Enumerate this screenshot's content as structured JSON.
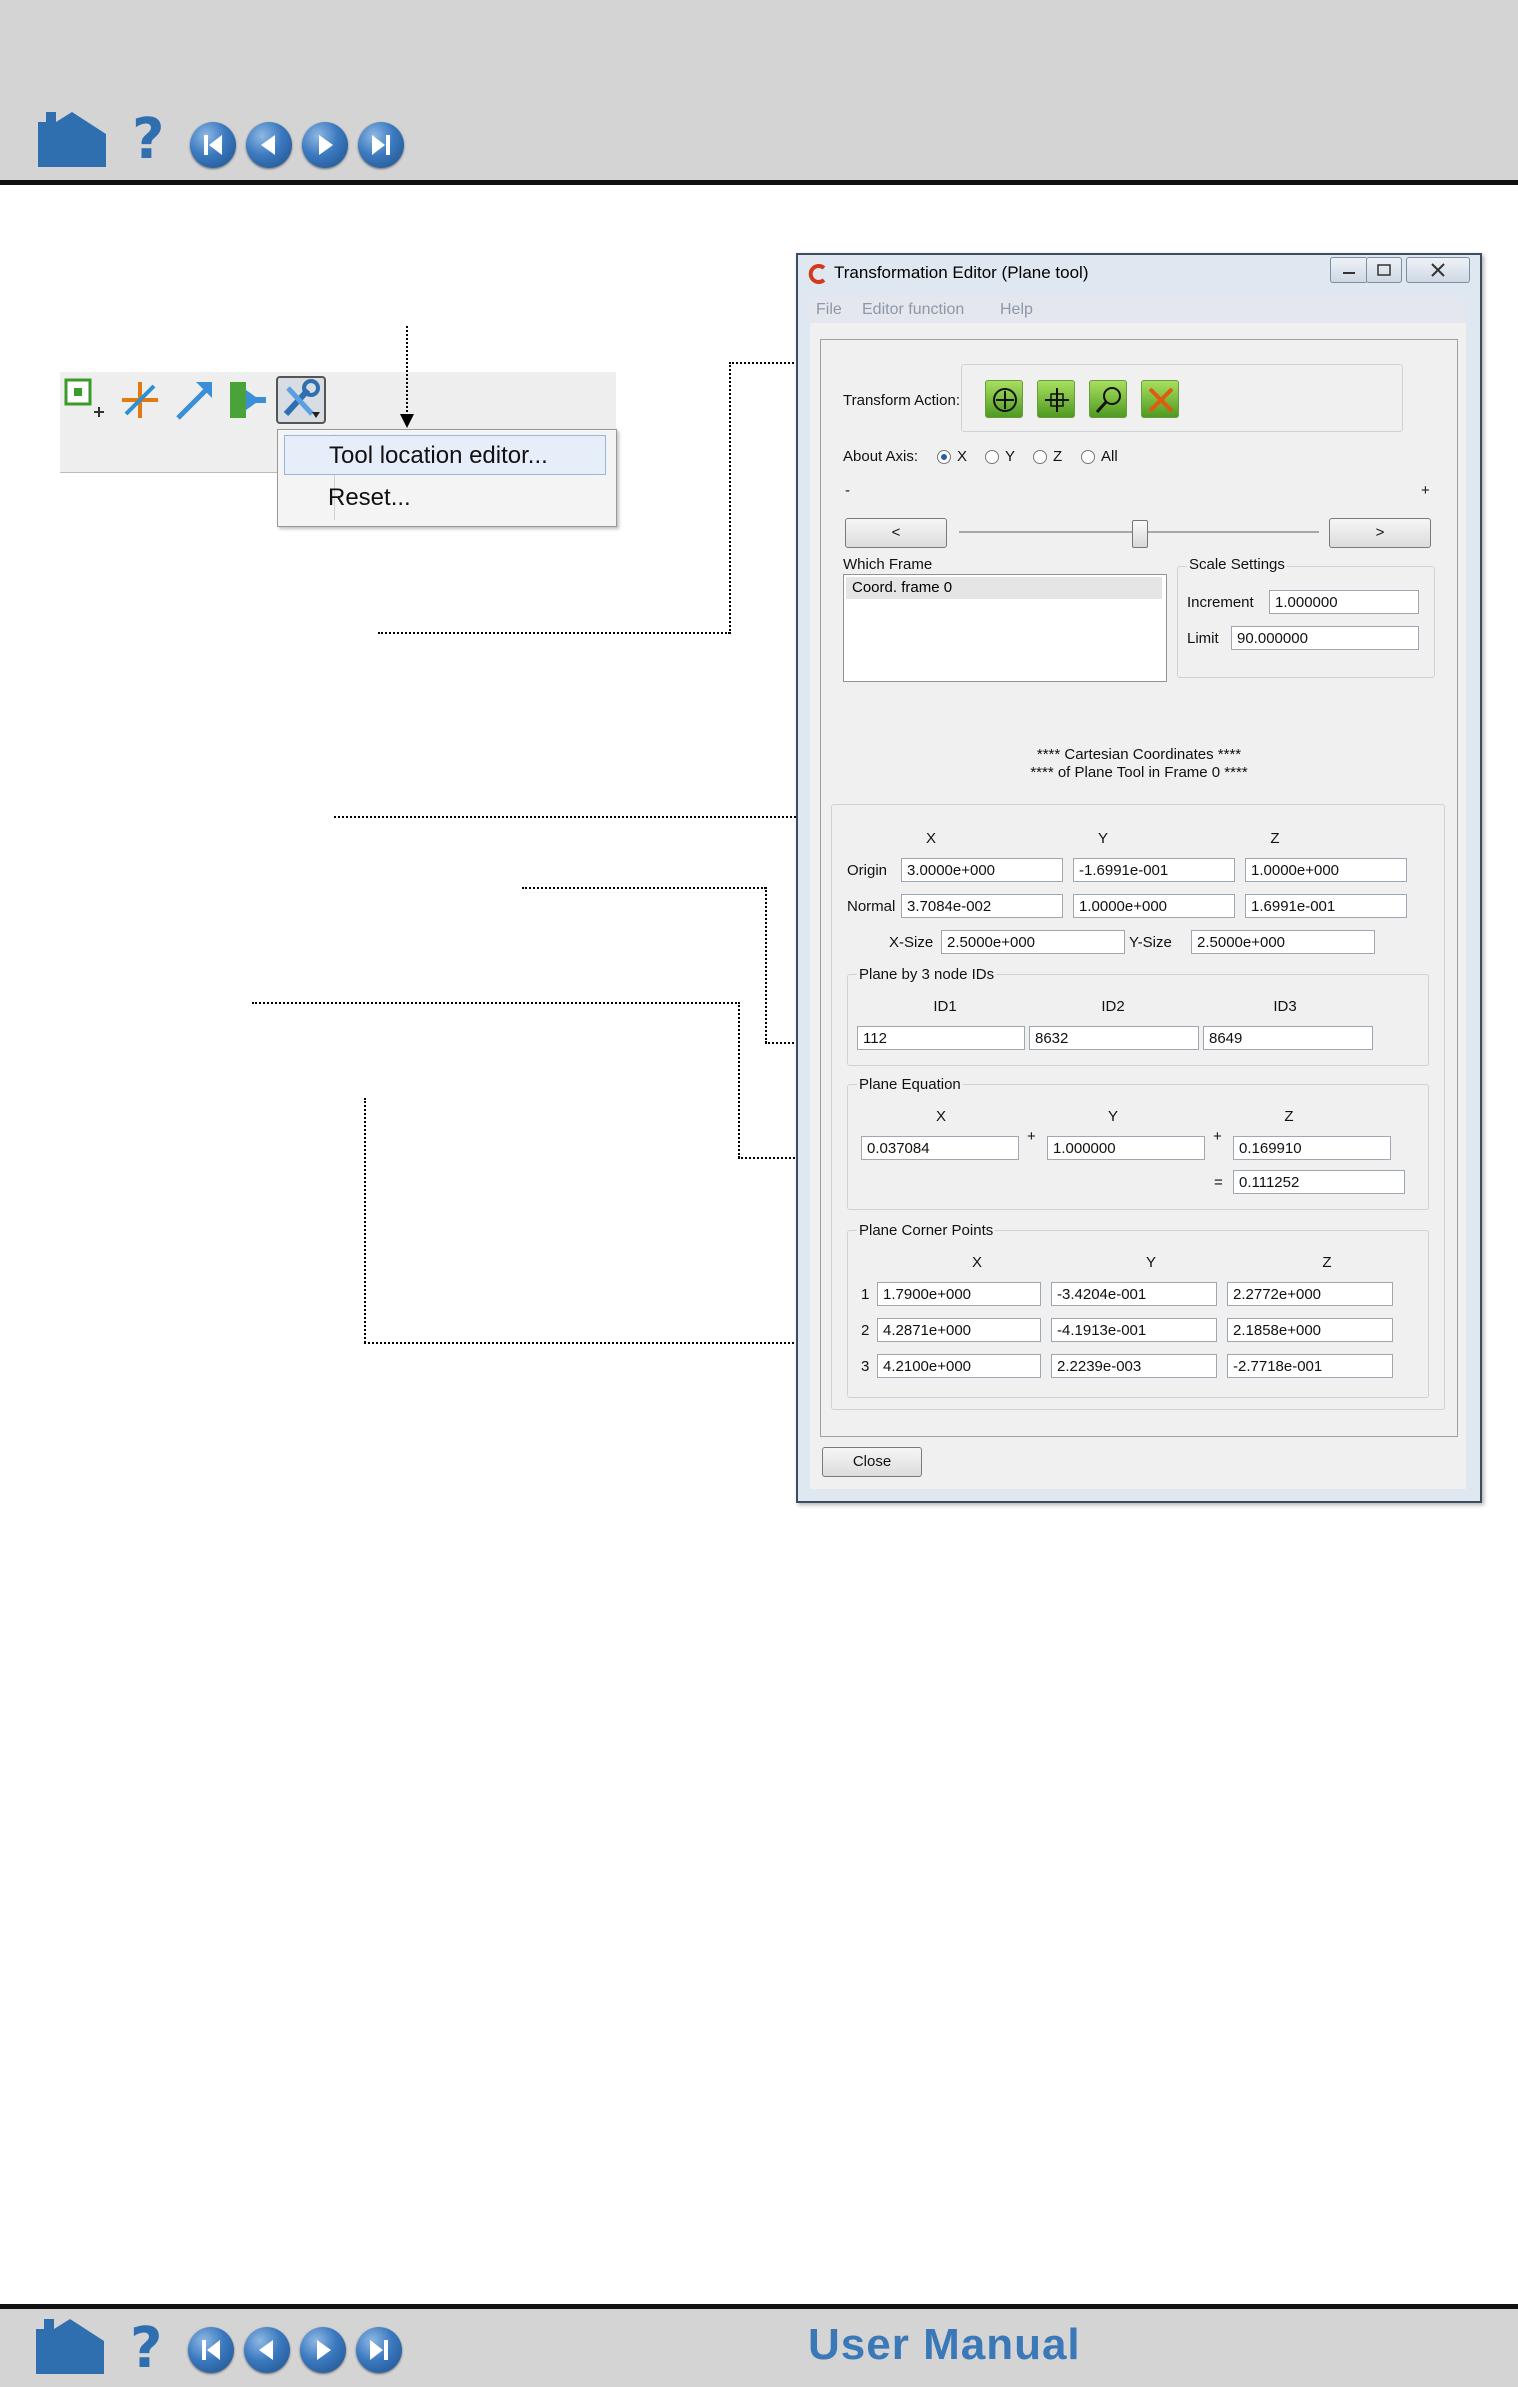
{
  "nav": {
    "home_icon": "home-icon",
    "help_icon": "help-icon",
    "help_glyph": "?",
    "buttons": [
      "first-page-icon",
      "previous-page-icon",
      "next-page-icon",
      "last-page-icon"
    ],
    "bottom_title": "User Manual",
    "accent_color": "#3a78b8"
  },
  "toolbar": {
    "icons": [
      "add-part-icon",
      "plane-tool-icon",
      "arrow-tool-icon",
      "export-icon",
      "tools-icon"
    ]
  },
  "tool_menu": {
    "items": [
      "Tool location editor...",
      "Reset..."
    ]
  },
  "dialog": {
    "title": "Transformation Editor (Plane tool)",
    "menus": [
      "File",
      "Editor function",
      "Help"
    ],
    "transform_action_label": "Transform Action:",
    "transform_buttons": [
      "rotate-icon",
      "translate-icon",
      "zoom-icon",
      "scale-icon"
    ],
    "about_axis_label": "About Axis:",
    "axes": [
      "X",
      "Y",
      "Z",
      "All"
    ],
    "selected_axis": "X",
    "minus": "-",
    "plus": "+",
    "step_left": "<",
    "step_right": ">",
    "slider_position": 0.5,
    "which_frame_label": "Which Frame",
    "frames": [
      "Coord. frame 0"
    ],
    "scale_settings_label": "Scale Settings",
    "increment_label": "Increment",
    "increment_value": "1.000000",
    "limit_label": "Limit",
    "limit_value": "90.000000",
    "coords_heading_1": "**** Cartesian Coordinates ****",
    "coords_heading_2": "**** of Plane Tool in Frame 0 ****",
    "col_x": "X",
    "col_y": "Y",
    "col_z": "Z",
    "origin_label": "Origin",
    "origin": [
      "3.0000e+000",
      "-1.6991e-001",
      "1.0000e+000"
    ],
    "normal_label": "Normal",
    "normal": [
      "3.7084e-002",
      "1.0000e+000",
      "1.6991e-001"
    ],
    "xsize_label": "X-Size",
    "xsize": "2.5000e+000",
    "ysize_label": "Y-Size",
    "ysize": "2.5000e+000",
    "node_ids_label": "Plane by 3 node IDs",
    "id_headers": [
      "ID1",
      "ID2",
      "ID3"
    ],
    "ids": [
      "112",
      "8632",
      "8649"
    ],
    "plane_eq_label": "Plane Equation",
    "eq_values": [
      "0.037084",
      "1.000000",
      "0.169910"
    ],
    "eq_plus": "+",
    "eq_equals": "=",
    "eq_rhs": "0.111252",
    "corner_label": "Plane Corner Points",
    "corners": [
      {
        "n": "1",
        "x": "1.7900e+000",
        "y": "-3.4204e-001",
        "z": "2.2772e+000"
      },
      {
        "n": "2",
        "x": "4.2871e+000",
        "y": "-4.1913e-001",
        "z": "2.1858e+000"
      },
      {
        "n": "3",
        "x": "4.2100e+000",
        "y": "2.2239e-003",
        "z": "-2.7718e-001"
      }
    ],
    "close_label": "Close"
  }
}
